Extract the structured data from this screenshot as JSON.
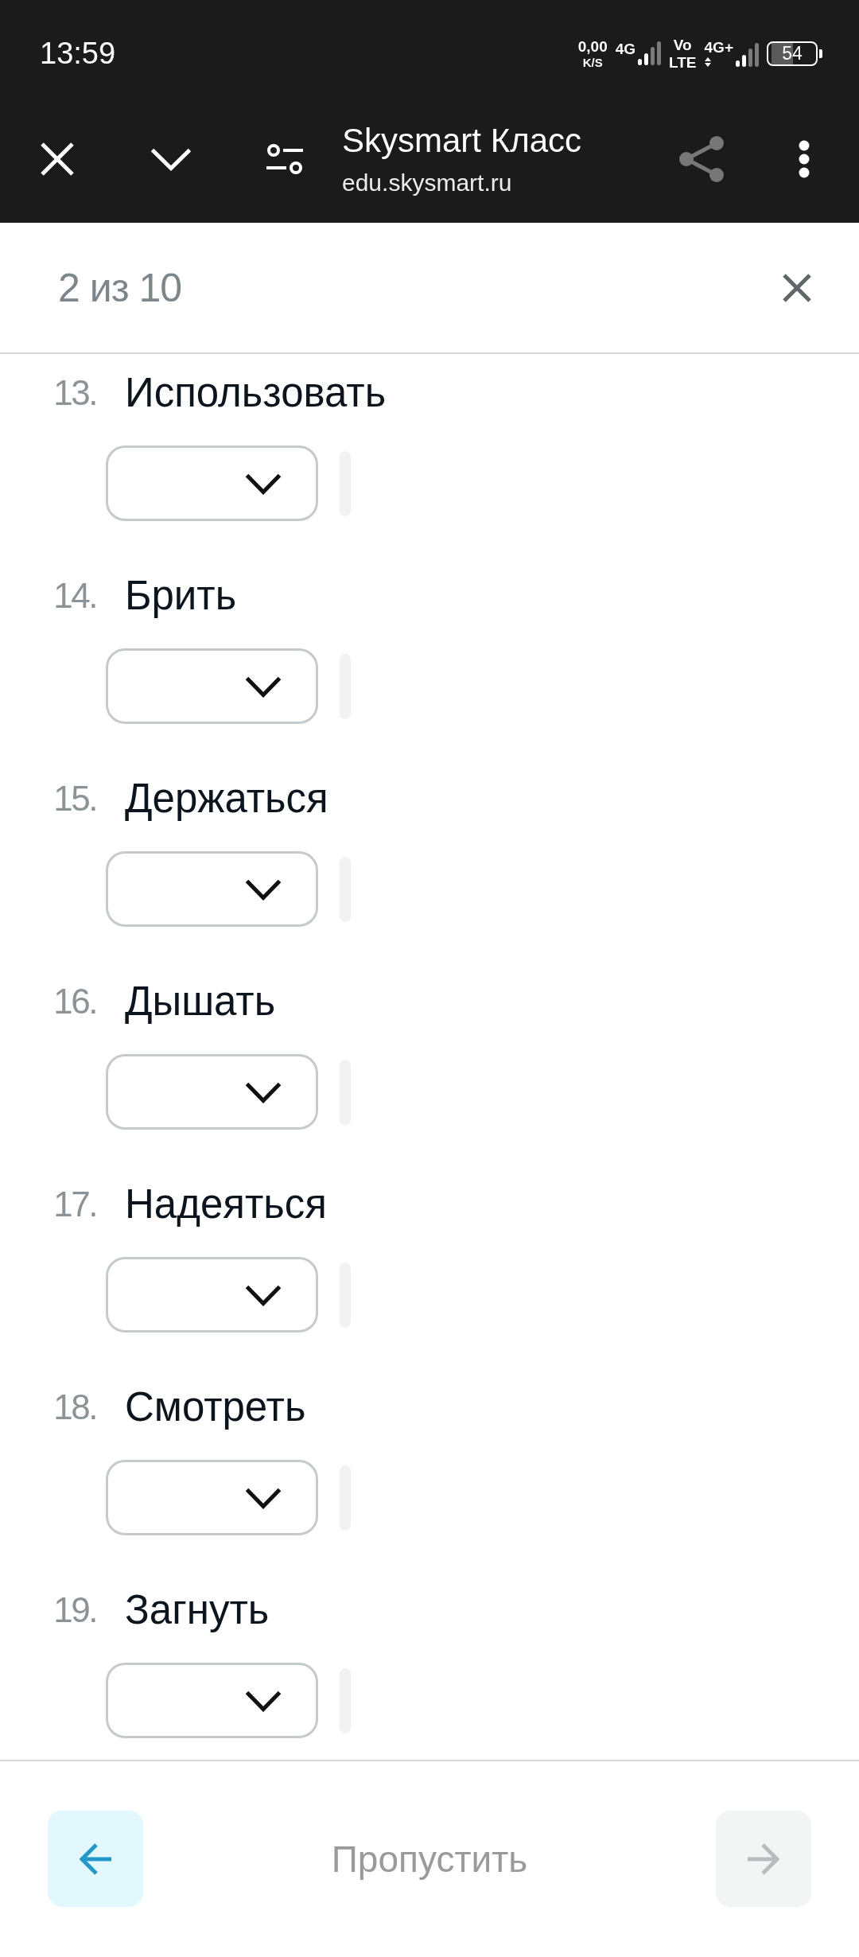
{
  "status_bar": {
    "time": "13:59",
    "net_speed": "0,00",
    "net_speed_unit": "K/S",
    "network_1": "4G",
    "volte": [
      "Vo",
      "LTE"
    ],
    "network_2": "4G+",
    "battery": "54"
  },
  "browser_bar": {
    "title": "Skysmart Класс",
    "url": "edu.skysmart.ru"
  },
  "task_header": {
    "progress": "2 из 10"
  },
  "items": [
    {
      "number": "13.",
      "word": "Использовать"
    },
    {
      "number": "14.",
      "word": "Брить"
    },
    {
      "number": "15.",
      "word": "Держаться"
    },
    {
      "number": "16.",
      "word": "Дышать"
    },
    {
      "number": "17.",
      "word": "Надеяться"
    },
    {
      "number": "18.",
      "word": "Смотреть"
    },
    {
      "number": "19.",
      "word": "Загнуть"
    }
  ],
  "footer": {
    "back_button": {
      "disabled": false
    },
    "skip_label": "Пропустить",
    "next_button": {
      "disabled": true
    }
  }
}
